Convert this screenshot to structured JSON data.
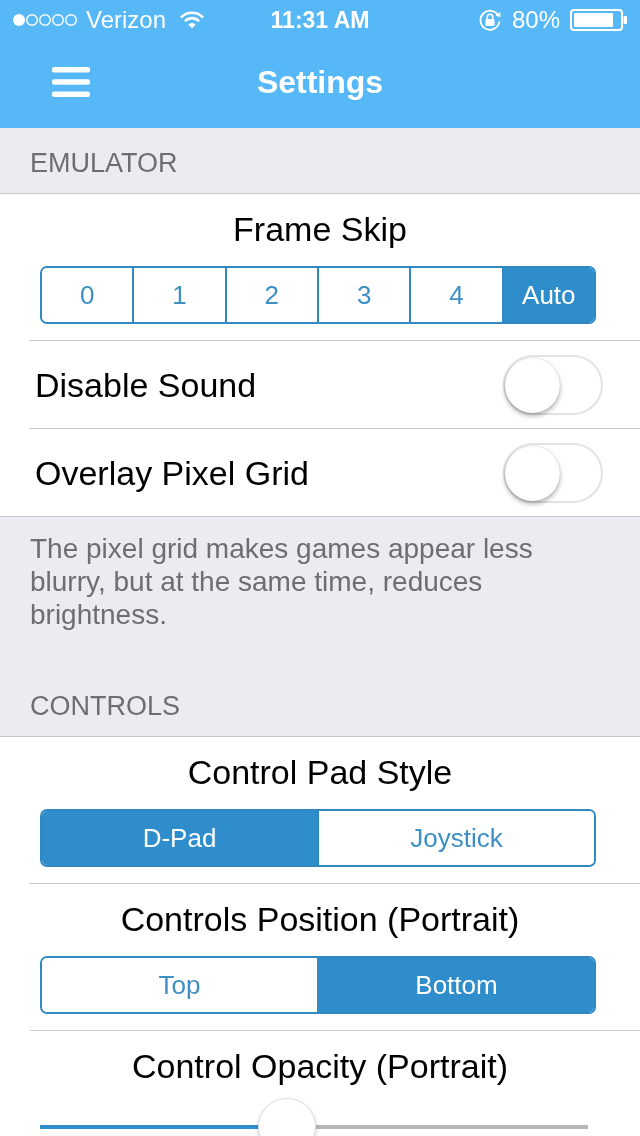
{
  "status_bar": {
    "carrier": "Verizon",
    "time": "11:31 AM",
    "battery": "80%"
  },
  "nav_bar": {
    "title": "Settings"
  },
  "sections": [
    {
      "header": "EMULATOR",
      "rows": [
        {
          "kind": "segmented",
          "title": "Frame Skip",
          "options": [
            {
              "label": "0",
              "selected": false
            },
            {
              "label": "1",
              "selected": false
            },
            {
              "label": "2",
              "selected": false
            },
            {
              "label": "3",
              "selected": false
            },
            {
              "label": "4",
              "selected": false
            },
            {
              "label": "Auto",
              "selected": true
            }
          ]
        },
        {
          "kind": "switch",
          "label": "Disable Sound",
          "on": false
        },
        {
          "kind": "switch",
          "label": "Overlay Pixel Grid",
          "on": false
        }
      ],
      "footer": "The pixel grid makes games appear less blurry, but at the same time, reduces brightness."
    },
    {
      "header": "CONTROLS",
      "rows": [
        {
          "kind": "segmented",
          "title": "Control Pad Style",
          "options": [
            {
              "label": "D-Pad",
              "selected": true
            },
            {
              "label": "Joystick",
              "selected": false
            }
          ]
        },
        {
          "kind": "segmented",
          "title": "Controls Position (Portrait)",
          "options": [
            {
              "label": "Top",
              "selected": false
            },
            {
              "label": "Bottom",
              "selected": true
            }
          ]
        },
        {
          "kind": "slider",
          "title": "Control Opacity (Portrait)",
          "level": 0.45
        }
      ]
    }
  ]
}
